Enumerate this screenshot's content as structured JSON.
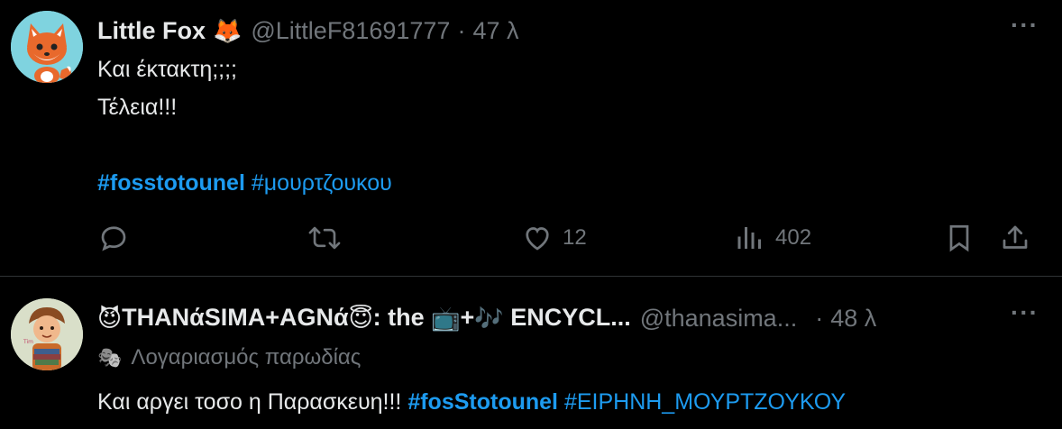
{
  "tweets": [
    {
      "display_name": "Little Fox",
      "name_emoji": "🦊",
      "handle": "@LittleF81691777",
      "separator": "·",
      "time": "47 λ",
      "more": "···",
      "lines": [
        "Και έκτακτη;;;;",
        "Τέλεια!!!"
      ],
      "hashtags": [
        "#fosstotounel",
        "#μουρτζουκου"
      ],
      "actions": {
        "reply_count": "",
        "repost_count": "",
        "like_count": "12",
        "views_count": "402"
      },
      "icons": [
        "reply-icon",
        "repost-icon",
        "like-icon",
        "views-icon",
        "bookmark-icon",
        "share-icon"
      ]
    },
    {
      "display_name_prefix_emoji": "😈",
      "display_name_part1": "THANάSIMA+AGNά",
      "display_name_emoji2": "😇",
      "display_name_part2": ": the ",
      "display_name_emoji3": "📺",
      "display_name_part3": "+",
      "display_name_emoji4": "🎶",
      "display_name_part4": " ENCYCL...",
      "handle": "@thanasima...",
      "separator": "·",
      "time": "48 λ",
      "more": "···",
      "parody_icon": "🎭",
      "parody_label": "Λογαριασμός παρωδίας",
      "text": "Και αργει τοσο η Παρασκευη!!! ",
      "hashtags": [
        "#fosStotounel",
        "#ΕΙΡΗΝΗ_ΜΟΥΡΤΖΟΥΚΟΥ"
      ]
    }
  ],
  "colors": {
    "background": "#000000",
    "text": "#e7e9ea",
    "secondary": "#71767b",
    "accent": "#1d9bf0",
    "divider": "#2f3336"
  }
}
